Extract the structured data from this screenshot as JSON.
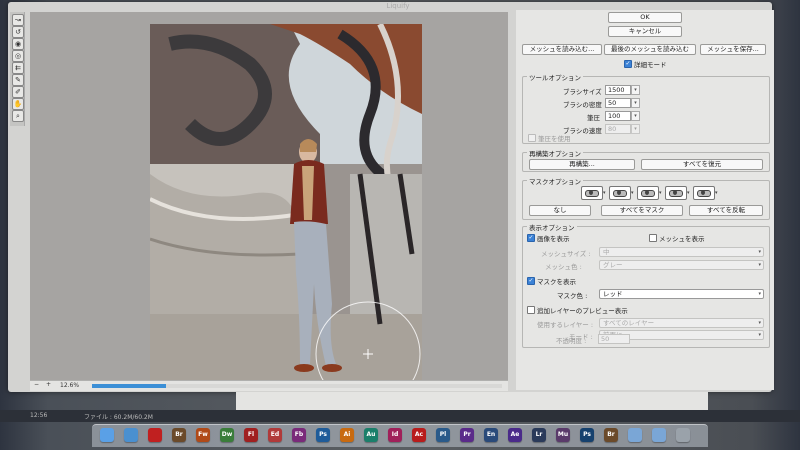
{
  "window": {
    "title": "Liquify",
    "document_info": "ファイル : 60.2M/60.2M",
    "time_readout": "12:56"
  },
  "canvas": {
    "zoom": "12.6%",
    "render_progress": 0.18
  },
  "panel": {
    "ok_label": "OK",
    "cancel_label": "キャンセル",
    "load_mesh_label": "メッシュを読み込む...",
    "load_last_mesh_label": "最後のメッシュを読み込む",
    "save_mesh_label": "メッシュを保存...",
    "advanced_mode": {
      "label": "詳細モード",
      "checked": true
    },
    "tool_options": {
      "title": "ツールオプション",
      "brush_size": {
        "label": "ブラシサイズ",
        "value": "1500"
      },
      "brush_density": {
        "label": "ブラシの密度",
        "value": "50"
      },
      "brush_pressure": {
        "label": "筆圧",
        "value": "100"
      },
      "brush_rate": {
        "label": "ブラシの速度",
        "value": "80"
      },
      "stylus_pressure": {
        "label": "筆圧を使用",
        "checked": false
      }
    },
    "reconstruct_options": {
      "title": "再構築オプション",
      "reconstruct_label": "再構築...",
      "restore_all_label": "すべてを復元"
    },
    "mask_options": {
      "title": "マスクオプション",
      "none_label": "なし",
      "mask_all_label": "すべてをマスク",
      "invert_all_label": "すべてを反転"
    },
    "view_options": {
      "title": "表示オプション",
      "show_image": {
        "label": "画像を表示",
        "checked": true
      },
      "show_mesh": {
        "label": "メッシュを表示",
        "checked": false
      },
      "mesh_size": {
        "label": "メッシュサイズ :",
        "value": "中"
      },
      "mesh_color": {
        "label": "メッシュ色 :",
        "value": "グレー"
      },
      "show_mask": {
        "label": "マスクを表示",
        "checked": true
      },
      "mask_color": {
        "label": "マスク色 :",
        "value": "レッド"
      },
      "show_backdrop": {
        "label": "追加レイヤーのプレビュー表示",
        "checked": false
      },
      "use_layer": {
        "label": "使用するレイヤー :",
        "value": "すべてのレイヤー"
      },
      "mode": {
        "label": "モード :",
        "value": "前面に"
      },
      "opacity": {
        "label": "不透明度 :",
        "value": "50"
      }
    }
  },
  "dock": {
    "apps": [
      {
        "icon": "finder-icon",
        "label": "",
        "color": "#5aa0e6"
      },
      {
        "icon": "safari-icon",
        "label": "",
        "color": "#4a90d0"
      },
      {
        "icon": "acrobat-icon",
        "label": "",
        "color": "#c02020"
      },
      {
        "icon": "bridge-icon",
        "label": "Br",
        "color": "#6b4a2a"
      },
      {
        "icon": "fireworks-icon",
        "label": "Fw",
        "color": "#b04a18"
      },
      {
        "icon": "dreamweaver-icon",
        "label": "Dw",
        "color": "#3a7d3a"
      },
      {
        "icon": "flash-icon",
        "label": "Fl",
        "color": "#a02020"
      },
      {
        "icon": "edge-icon",
        "label": "Ed",
        "color": "#b03a3a"
      },
      {
        "icon": "flash-builder-icon",
        "label": "Fb",
        "color": "#7a2a7a"
      },
      {
        "icon": "photoshop-icon",
        "label": "Ps",
        "color": "#1f5c9a"
      },
      {
        "icon": "illustrator-icon",
        "label": "Ai",
        "color": "#c86a10"
      },
      {
        "icon": "audition-icon",
        "label": "Au",
        "color": "#1b7f6b"
      },
      {
        "icon": "indesign-icon",
        "label": "Id",
        "color": "#a0205a"
      },
      {
        "icon": "acrobat-pro-icon",
        "label": "Ac",
        "color": "#b81c1c"
      },
      {
        "icon": "prelude-icon",
        "label": "Pl",
        "color": "#2a5a8a"
      },
      {
        "icon": "premiere-icon",
        "label": "Pr",
        "color": "#5a2a8a"
      },
      {
        "icon": "encore-icon",
        "label": "En",
        "color": "#2a4a7a"
      },
      {
        "icon": "ae-icon",
        "label": "Ae",
        "color": "#4a2a8a"
      },
      {
        "icon": "lightroom-icon",
        "label": "Lr",
        "color": "#2a3a5a"
      },
      {
        "icon": "muse-icon",
        "label": "Mu",
        "color": "#5a3a6a"
      },
      {
        "icon": "photoshop-cs-icon",
        "label": "Ps",
        "color": "#16416e"
      },
      {
        "icon": "bridge-cs-icon",
        "label": "Br",
        "color": "#6b4a2a"
      },
      {
        "icon": "folder-icon",
        "label": "",
        "color": "#7aa6d6"
      },
      {
        "icon": "downloads-icon",
        "label": "",
        "color": "#7aa6d6"
      },
      {
        "icon": "trash-icon",
        "label": "",
        "color": "#9aa2aa"
      }
    ]
  },
  "colors": {
    "accent": "#3b82d6",
    "panel_bg": "#e6e6e4",
    "canvas_bg": "#a6a4a2"
  }
}
